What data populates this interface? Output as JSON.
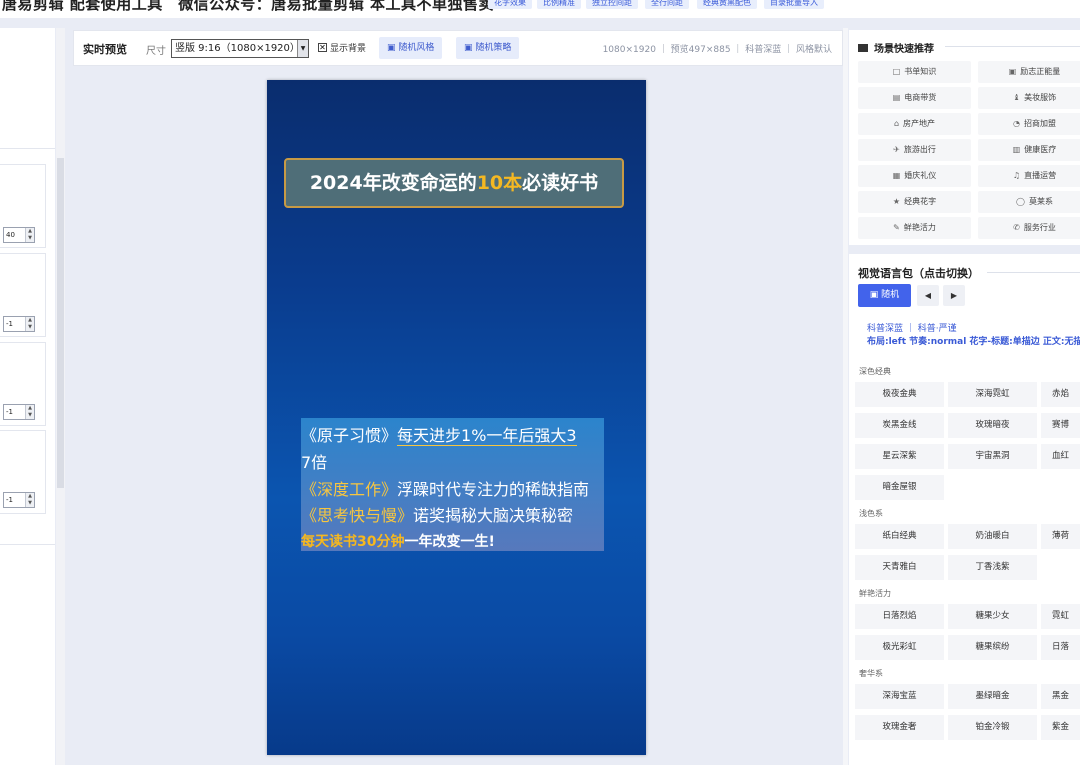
{
  "top_banner": {
    "title": "唐易剪辑 配套使用工具　微信公众号：唐易批量剪辑 本工具不单独售卖",
    "tags": [
      "花字效果",
      "比例精准",
      "独立控间距",
      "全行间距",
      "经典黄黑配色",
      "目录批量导入"
    ]
  },
  "left_panel": {
    "inputs": [
      "40",
      "-1",
      "-1",
      "-1"
    ]
  },
  "toolbar": {
    "preview_label": "实时预览",
    "size_label": "尺寸",
    "size_value": "竖版 9:16（1080×1920）",
    "show_bg_checked": true,
    "show_bg_label": "显示背景",
    "random_style_label": "随机风格",
    "random_strategy_label": "随机策略",
    "info": "1080×1920 ｜ 预览497×885 ｜ 科普深蓝 ｜ 风格默认"
  },
  "canvas": {
    "headline_pre": "2024年改变命运的",
    "headline_highlight": "10本",
    "headline_post": "必读好书",
    "lines": {
      "l1_book": "《原子习惯》",
      "l1_rest": "每天进步1%一年后强大3",
      "l1_wrap": "7倍",
      "l2_book": "《深度工作》",
      "l2_rest": "浮躁时代专注力的稀缺指南",
      "l3_book": "《思考快与慢》",
      "l3_rest": "诺奖揭秘大脑决策秘密",
      "l4_gold": "每天读书30分钟",
      "l4_rest": "一年改变一生!"
    }
  },
  "scene_panel": {
    "title": "场景快速推荐",
    "items": [
      {
        "icon": "□",
        "label": "书单知识"
      },
      {
        "icon": "▣",
        "label": "励志正能量"
      },
      {
        "icon": "▤",
        "label": "电商带货"
      },
      {
        "icon": "♝",
        "label": "美妆服饰"
      },
      {
        "icon": "⌂",
        "label": "房产地产"
      },
      {
        "icon": "◔",
        "label": "招商加盟"
      },
      {
        "icon": "✈",
        "label": "旅游出行"
      },
      {
        "icon": "▥",
        "label": "健康医疗"
      },
      {
        "icon": "▦",
        "label": "婚庆礼仪"
      },
      {
        "icon": "♫",
        "label": "直播运营"
      },
      {
        "icon": "★",
        "label": "经典花字"
      },
      {
        "icon": "◯",
        "label": "莫莱系"
      },
      {
        "icon": "✎",
        "label": "鲜艳活力"
      },
      {
        "icon": "✆",
        "label": "服务行业"
      }
    ]
  },
  "visual_panel": {
    "title": "视觉语言包（点击切换）",
    "random_label": "随机",
    "prev_label": "◀",
    "next_label": "▶",
    "meta_line1": "科普深蓝 ｜ 科普·严谨",
    "meta_line2": "布局:left  节奏:normal  花字-标题:单描边  正文:无描边",
    "sections": [
      {
        "title": "深色经典",
        "items": [
          "极夜金典",
          "深海霓虹",
          "赤焰",
          "炭黑金线",
          "玫瑰暗夜",
          "赛博",
          "星云深紫",
          "宇宙黑洞",
          "血红",
          "暗金屋银"
        ]
      },
      {
        "title": "浅色系",
        "items": [
          "纸白经典",
          "奶油暖白",
          "薄荷",
          "天青雅白",
          "丁香浅紫"
        ]
      },
      {
        "title": "鲜艳活力",
        "items": [
          "日落烈焰",
          "糖果少女",
          "霓虹",
          "极光彩虹",
          "糖果缤纷",
          "日落"
        ]
      },
      {
        "title": "奢华系",
        "items": [
          "深海宝蓝",
          "墨绿暗金",
          "黑金",
          "玫瑰金奢",
          "铂金冷锻",
          "紫金"
        ]
      }
    ]
  },
  "colors": {
    "accent": "#4263eb",
    "canvas_top": "#0a2d6e",
    "canvas_bottom": "#0b55b0",
    "gold": "#f4b822"
  }
}
